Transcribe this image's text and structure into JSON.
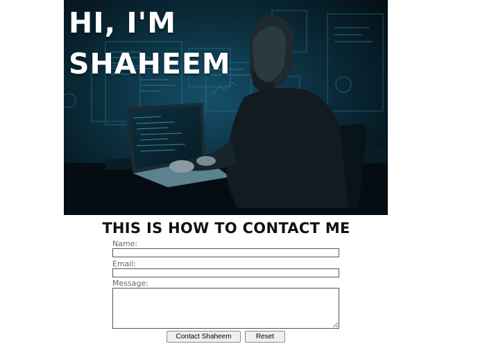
{
  "hero": {
    "title_line1": "HI, I'M",
    "title_line2": "SHAHEEM",
    "image": "developer-at-laptop-photo"
  },
  "contact": {
    "heading": "THIS IS HOW TO CONTACT ME",
    "name_label": "Name:",
    "name_value": "",
    "email_label": "Email:",
    "email_value": "",
    "message_label": "Message:",
    "message_value": "",
    "submit_label": "Contact Shaheem",
    "reset_label": "Reset"
  },
  "colors": {
    "hero_bg": "#061821",
    "hero_glow": "#1b6a82",
    "text": "#111111",
    "label": "#666666"
  }
}
